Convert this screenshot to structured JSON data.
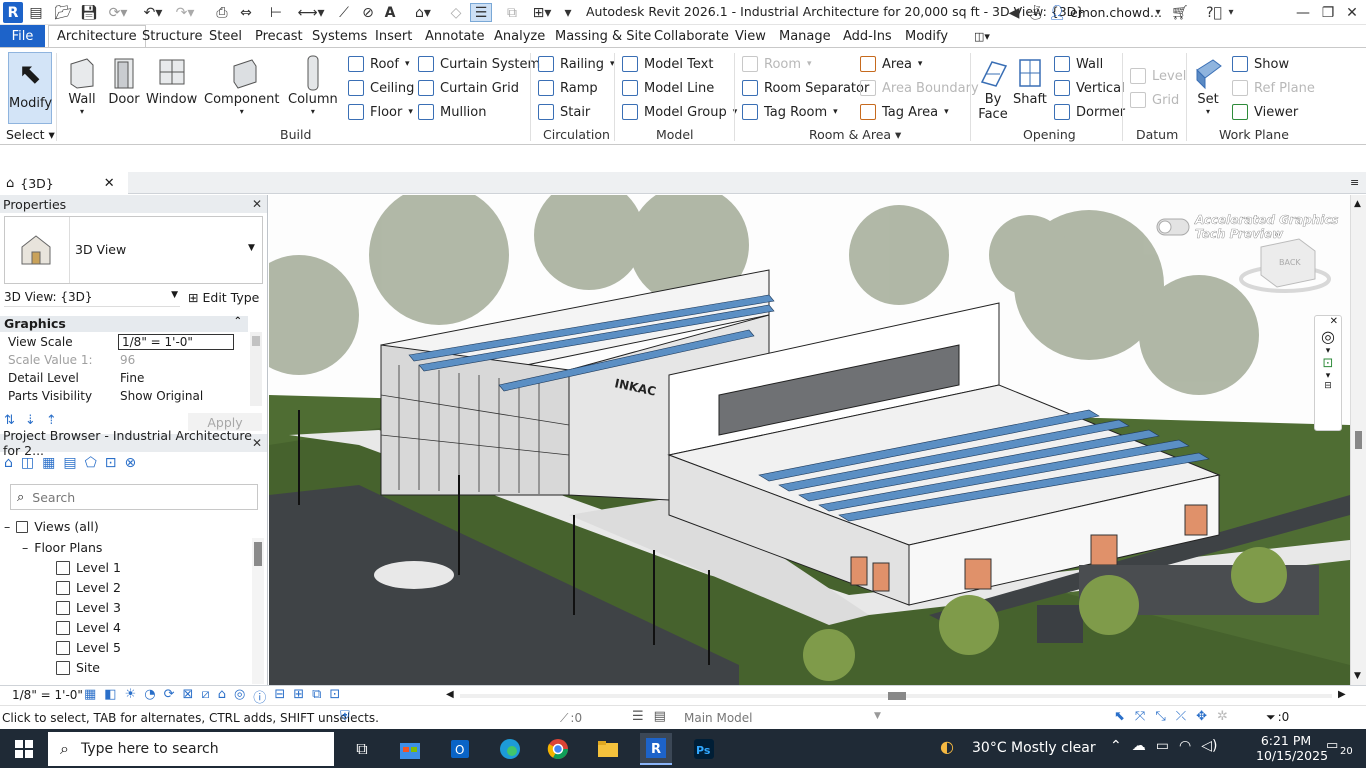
{
  "window": {
    "title": "Autodesk Revit 2026.1 - Industrial Architecture for 20,000 sq ft - 3D View: {3D}",
    "user": "emon.chowd...",
    "logo": "R"
  },
  "menu": {
    "file": "File",
    "tabs": [
      "Architecture",
      "Structure",
      "Steel",
      "Precast",
      "Systems",
      "Insert",
      "Annotate",
      "Analyze",
      "Massing & Site",
      "Collaborate",
      "View",
      "Manage",
      "Add-Ins",
      "Modify"
    ]
  },
  "ribbon": {
    "select": {
      "modify": "Modify",
      "label": "Select"
    },
    "build": {
      "label": "Build",
      "wall": "Wall",
      "door": "Door",
      "window": "Window",
      "component": "Component",
      "column": "Column",
      "roof": "Roof",
      "ceiling": "Ceiling",
      "floor": "Floor",
      "curtain_system": "Curtain System",
      "curtain_grid": "Curtain Grid",
      "mullion": "Mullion"
    },
    "circulation": {
      "label": "Circulation",
      "railing": "Railing",
      "ramp": "Ramp",
      "stair": "Stair"
    },
    "model": {
      "label": "Model",
      "model_text": "Model Text",
      "model_line": "Model Line",
      "model_group": "Model Group"
    },
    "room_area": {
      "label": "Room & Area",
      "room": "Room",
      "room_separator": "Room Separator",
      "tag_room": "Tag Room",
      "area": "Area",
      "area_boundary": "Area Boundary",
      "tag_area": "Tag Area"
    },
    "opening": {
      "label": "Opening",
      "by_face_1": "By",
      "by_face_2": "Face",
      "shaft": "Shaft",
      "wall": "Wall",
      "vertical": "Vertical",
      "dormer": "Dormer"
    },
    "datum": {
      "label": "Datum",
      "level": "Level",
      "grid": "Grid"
    },
    "work_plane": {
      "label": "Work Plane",
      "set": "Set",
      "show": "Show",
      "ref_plane": "Ref Plane",
      "viewer": "Viewer"
    }
  },
  "view_tab": {
    "label": "{3D}"
  },
  "properties": {
    "header": "Properties",
    "type_name": "3D View",
    "instance": "3D View: {3D}",
    "edit_type": "Edit Type",
    "section": "Graphics",
    "rows": [
      {
        "k": "View Scale",
        "v": "1/8\" = 1'-0\""
      },
      {
        "k": "Scale Value    1:",
        "v": "96"
      },
      {
        "k": "Detail Level",
        "v": "Fine"
      },
      {
        "k": "Parts Visibility",
        "v": "Show Original"
      }
    ],
    "apply": "Apply"
  },
  "browser": {
    "header": "Project Browser - Industrial Architecture for 2...",
    "search_placeholder": "Search",
    "views_all": "Views (all)",
    "floor_plans": "Floor Plans",
    "items": [
      "Level 1",
      "Level 2",
      "Level 3",
      "Level 4",
      "Level 5",
      "Site"
    ]
  },
  "viewport": {
    "badge_line1": "Accelerated Graphics",
    "badge_line2": "Tech Preview",
    "viewcube": "BACK",
    "sign": "INKAC"
  },
  "view_control": {
    "scale": "1/8\" = 1'-0\""
  },
  "status": {
    "message": "Click to select, TAB for alternates, CTRL adds, SHIFT unselects.",
    "selected_count": ":0",
    "model": "Main Model",
    "filter_count": ":0"
  },
  "taskbar": {
    "search": "Type here to search",
    "weather": "30°C  Mostly clear",
    "time": "6:21 PM",
    "date": "10/15/2025",
    "notif_count": "20"
  },
  "colors": {
    "accent": "#1d63c9",
    "taskbar": "#1f2a36",
    "grass": "#4c6a2f",
    "panel": "#7aa8d6"
  }
}
